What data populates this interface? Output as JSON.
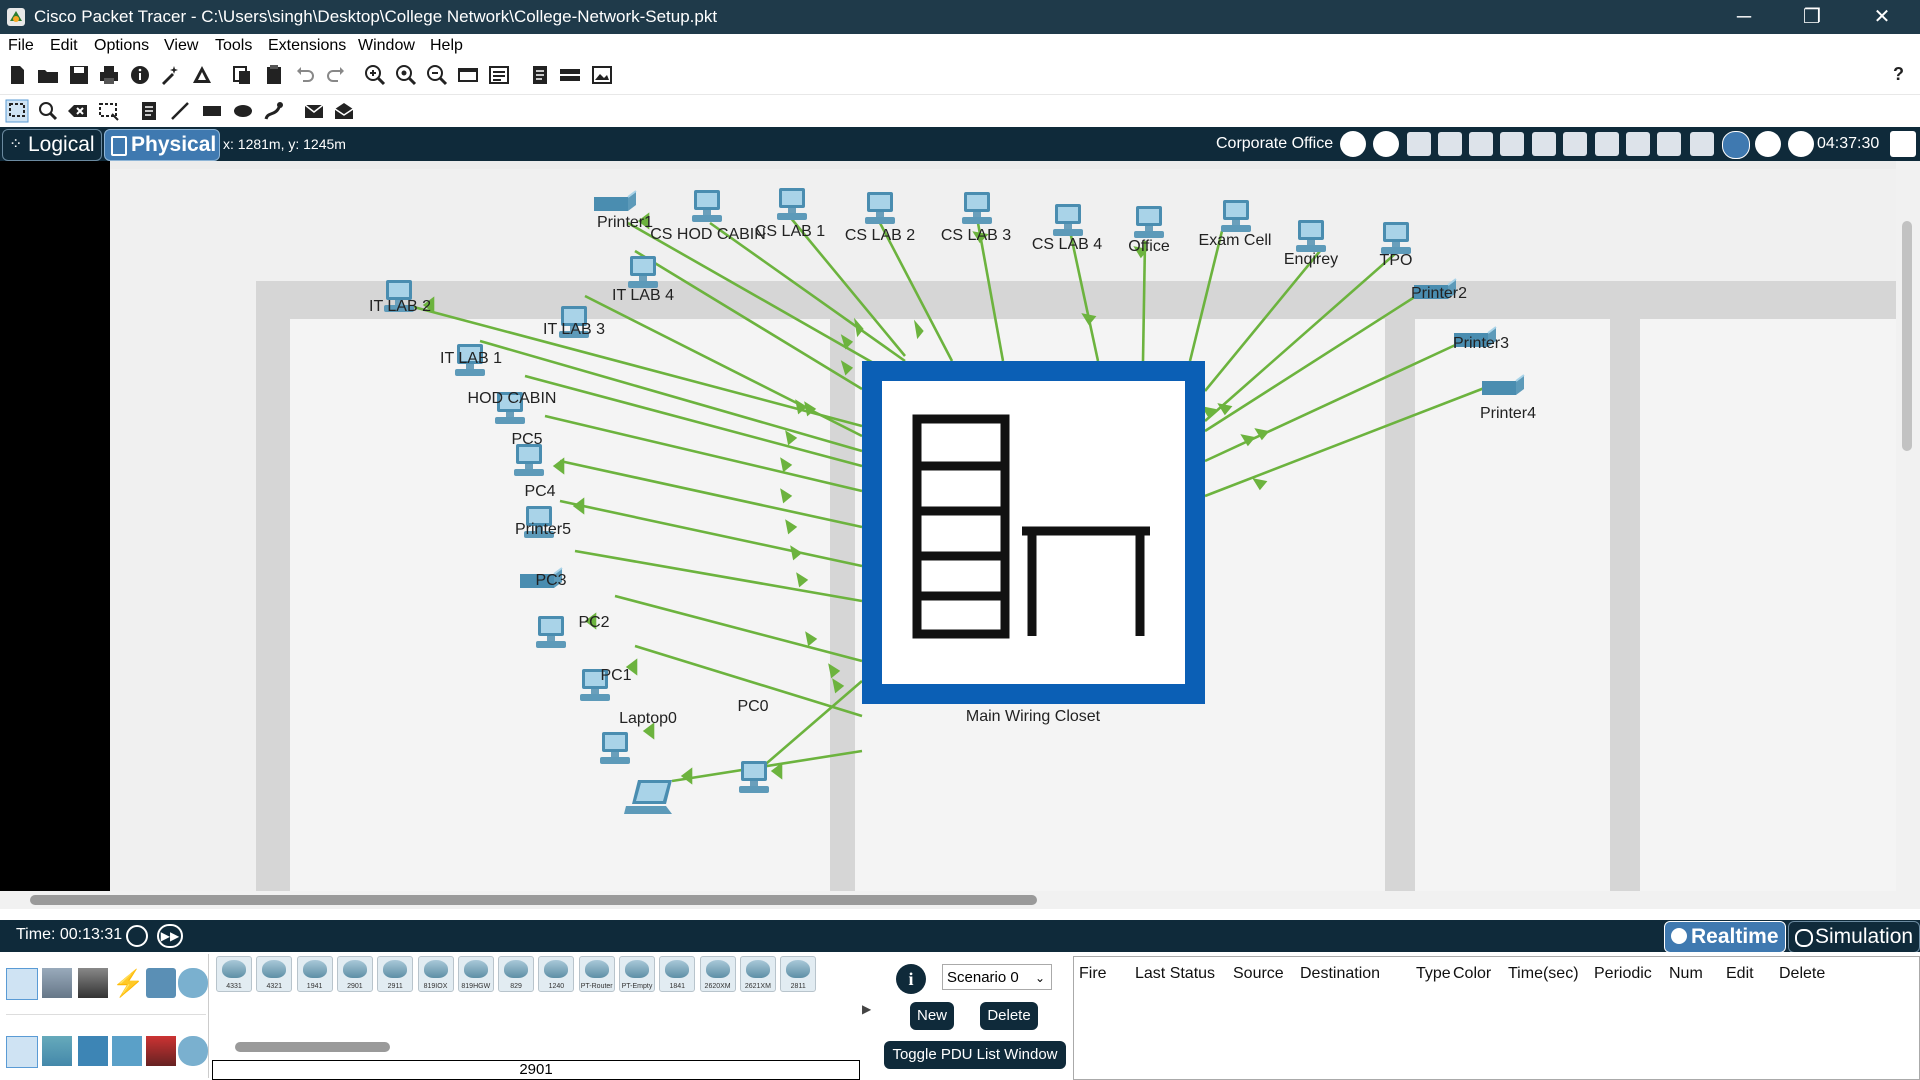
{
  "window": {
    "title": "Cisco Packet Tracer - C:\\Users\\singh\\Desktop\\College Network\\College-Network-Setup.pkt",
    "controls": [
      "─",
      "❐",
      "✕"
    ]
  },
  "menu": [
    "File",
    "Edit",
    "Options",
    "View",
    "Tools",
    "Extensions",
    "Window",
    "Help"
  ],
  "toolbar": {
    "help": "?"
  },
  "modebar": {
    "logical": "Logical",
    "physical": "Physical",
    "coords": "x: 1281m, y: 1245m",
    "location": "Corporate Office",
    "clock": "04:37:30"
  },
  "devices": {
    "printer1": "Printer1",
    "cs_hod_cabin": "CS HOD CABIN",
    "cs_lab_1": "CS LAB 1",
    "cs_lab_2": "CS LAB 2",
    "cs_lab_3": "CS LAB 3",
    "cs_lab_4": "CS LAB 4",
    "office": "Office",
    "exam_cell": "Exam Cell",
    "enquiry": "Enqirey",
    "tpo": "TPO",
    "printer2": "Printer2",
    "printer3": "Printer3",
    "printer4": "Printer4",
    "it_lab_2": "IT LAB 2",
    "it_lab_4": "IT LAB 4",
    "it_lab_3": "IT LAB 3",
    "it_lab_1": "IT LAB 1",
    "hod_cabin": "HOD CABIN",
    "pc5": "PC5",
    "pc4": "PC4",
    "printer5": "Printer5",
    "pc3": "PC3",
    "pc2": "PC2",
    "pc1": "PC1",
    "laptop0": "Laptop0",
    "pc0": "PC0",
    "closet": "Main Wiring Closet"
  },
  "timebar": {
    "time": "Time: 00:13:31",
    "realtime": "Realtime",
    "simulation": "Simulation"
  },
  "models": [
    "4331",
    "4321",
    "1941",
    "2901",
    "2911",
    "819IOX",
    "819HGW",
    "829",
    "1240",
    "PT-Router",
    "PT-Empty",
    "1841",
    "2620XM",
    "2621XM",
    "2811"
  ],
  "selected_model": "2901",
  "pdu": {
    "scenario": "Scenario 0",
    "new": "New",
    "delete": "Delete",
    "toggle": "Toggle PDU List Window",
    "columns": [
      "Fire",
      "Last Status",
      "Source",
      "Destination",
      "Type",
      "Color",
      "Time(sec)",
      "Periodic",
      "Num",
      "Edit",
      "Delete"
    ]
  },
  "colors": {
    "link": "#6cb33e",
    "closet_frame": "#0b5fb5",
    "dark_bar": "#0f2a3a",
    "title_bar": "#1f3a4a"
  }
}
